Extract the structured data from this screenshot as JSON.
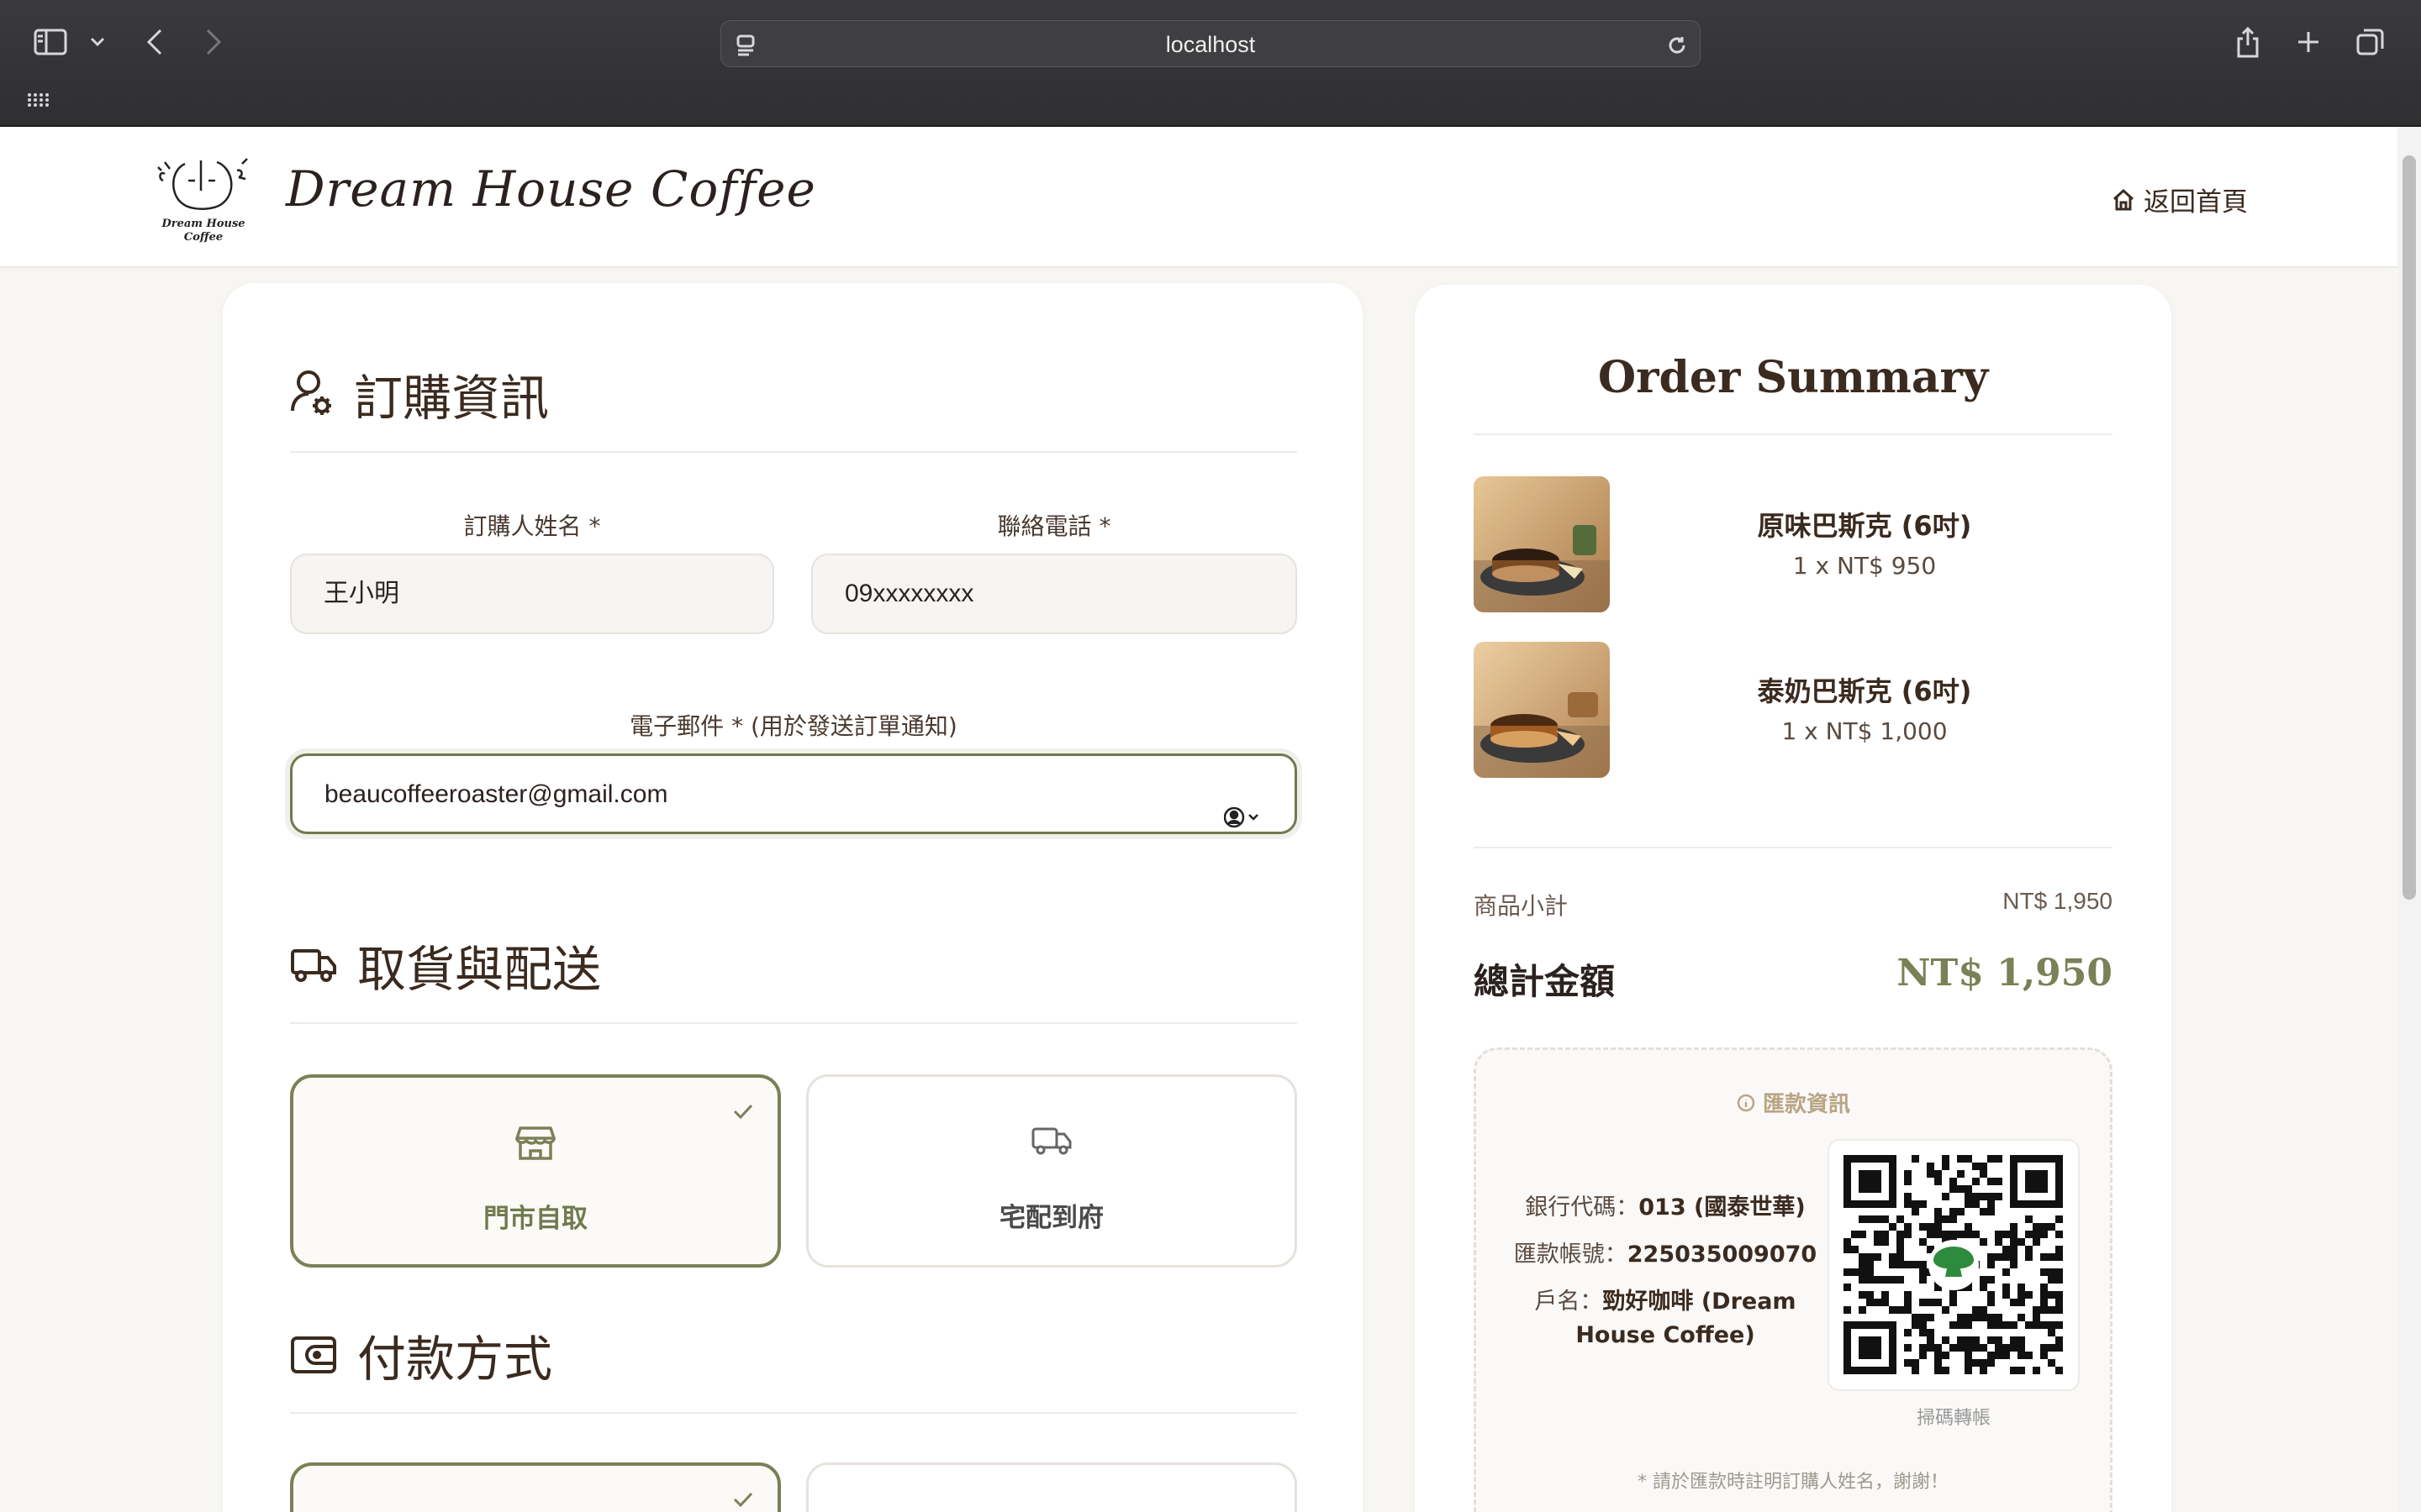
{
  "browser": {
    "url": "localhost"
  },
  "header": {
    "brand_name": "Dream House Coffee",
    "logo_text_line1": "Dream House",
    "logo_text_line2": "Coffee",
    "home_link": "返回首頁"
  },
  "order_info": {
    "section_title": "訂購資訊",
    "name_label": "訂購人姓名 *",
    "name_value": "王小明",
    "phone_label": "聯絡電話 *",
    "phone_value": "09xxxxxxxx",
    "email_label": "電子郵件 * (用於發送訂單通知)",
    "email_value": "beaucoffeeroaster@gmail.com"
  },
  "delivery": {
    "section_title": "取貨與配送",
    "options": [
      {
        "label": "門市自取",
        "selected": true
      },
      {
        "label": "宅配到府",
        "selected": false
      }
    ]
  },
  "payment": {
    "section_title": "付款方式"
  },
  "summary": {
    "title": "Order Summary",
    "items": [
      {
        "name": "原味巴斯克 (6吋)",
        "qty": "1 x NT$ 950"
      },
      {
        "name": "泰奶巴斯克 (6吋)",
        "qty": "1 x NT$ 1,000"
      }
    ],
    "subtotal_label": "商品小計",
    "subtotal_value": "NT$ 1,950",
    "total_label": "總計金額",
    "total_value": "NT$ 1,950"
  },
  "bank": {
    "title": "匯款資訊",
    "code_label": "銀行代碼：",
    "code_value": "013 (國泰世華)",
    "account_label": "匯款帳號：",
    "account_value": "225035009070",
    "holder_label": "戶名：",
    "holder_value": "勁好咖啡 (Dream House Coffee)",
    "qr_caption": "掃碼轉帳",
    "note": "* 請於匯款時註明訂購人姓名，謝謝！"
  },
  "colors": {
    "accent": "#7b8056",
    "text_dark": "#3b2a1f",
    "gold": "#b9a585"
  }
}
